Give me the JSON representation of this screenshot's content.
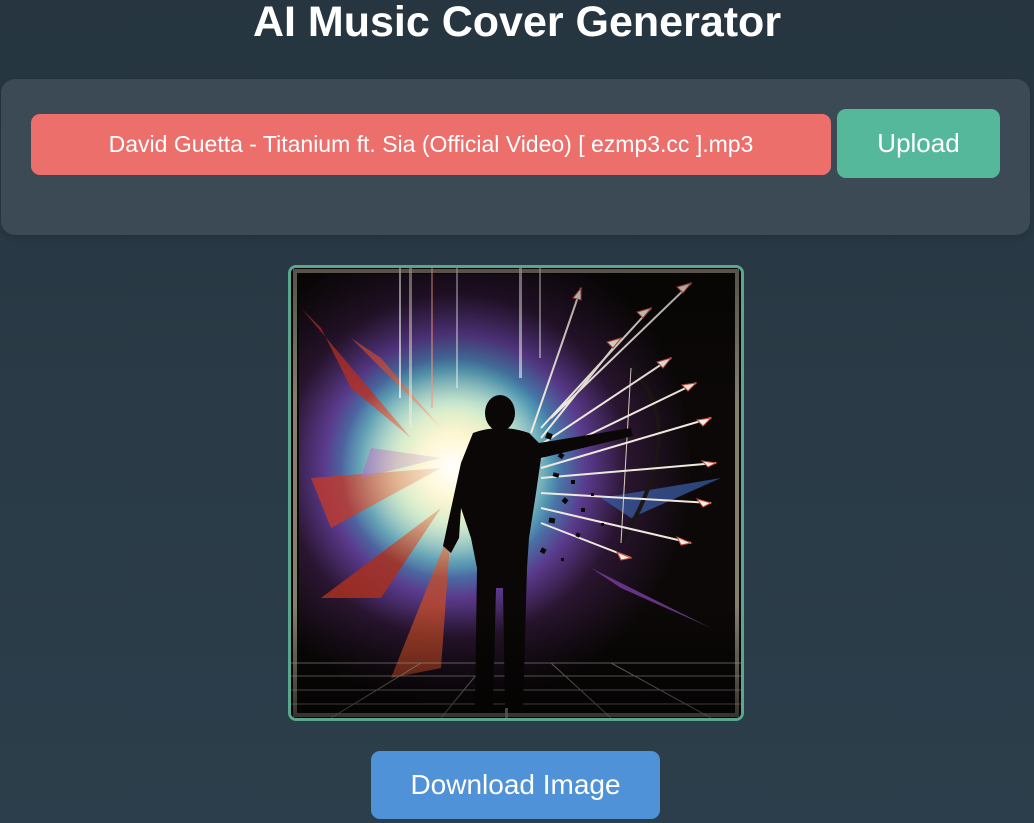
{
  "header": {
    "title": "AI Music Cover Generator"
  },
  "upload": {
    "file_name": "David Guetta - Titanium ft. Sia (Official Video) [ ezmp3.cc ].mp3",
    "button_label": "Upload"
  },
  "cover": {
    "alt": "Generated cover art: silhouette of an archer with a bow, dissolving into particles, in front of a bright colorful burst with flying arrows"
  },
  "actions": {
    "download_label": "Download Image"
  },
  "colors": {
    "background": "#2a3a46",
    "panel": "#3b4a55",
    "file_field": "#ec6f6c",
    "upload_button": "#55b89b",
    "download_button": "#4f92d8",
    "image_border": "#5aa690"
  }
}
